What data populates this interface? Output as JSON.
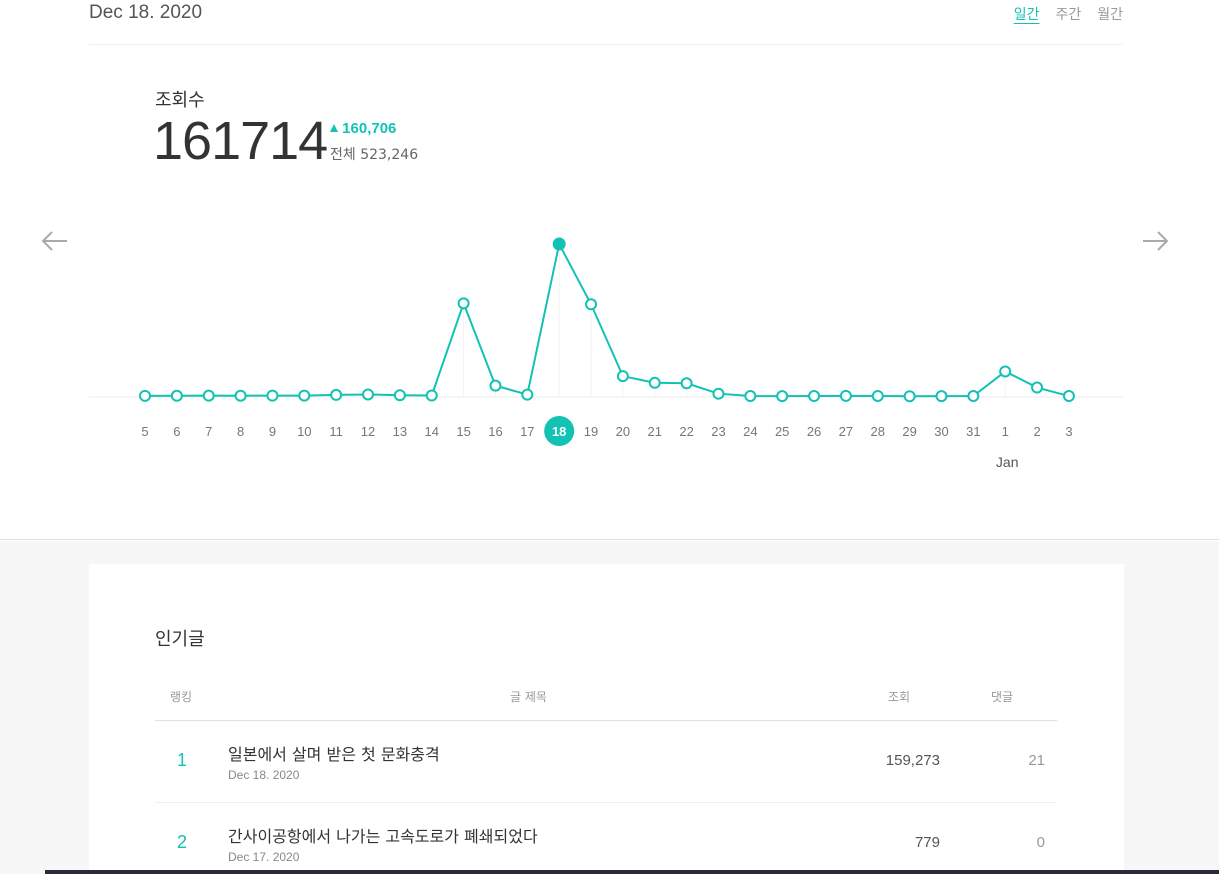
{
  "header": {
    "date_title": "Dec 18. 2020",
    "tabs": [
      {
        "label": "일간",
        "active": true
      },
      {
        "label": "주간",
        "active": false
      },
      {
        "label": "월간",
        "active": false
      }
    ]
  },
  "metric": {
    "label": "조회수",
    "value": "161714",
    "delta": "160,706",
    "total": "전체 523,246"
  },
  "icons": {
    "prev": "arrow-left-icon",
    "next": "arrow-right-icon",
    "delta": "triangle-up-icon"
  },
  "colors": {
    "accent": "#12c2b4"
  },
  "chart_data": {
    "type": "line",
    "categories": [
      "5",
      "6",
      "7",
      "8",
      "9",
      "10",
      "11",
      "12",
      "13",
      "14",
      "15",
      "16",
      "17",
      "18",
      "19",
      "20",
      "21",
      "22",
      "23",
      "24",
      "25",
      "26",
      "27",
      "28",
      "29",
      "30",
      "31",
      "1",
      "2",
      "3"
    ],
    "values": [
      1200,
      1300,
      1400,
      1350,
      1450,
      1500,
      2200,
      2700,
      1900,
      1600,
      99000,
      12000,
      2500,
      161714,
      98000,
      22000,
      15000,
      14500,
      3500,
      1000,
      900,
      1000,
      1200,
      1100,
      800,
      900,
      1000,
      27000,
      10000,
      1008
    ],
    "highlight": "18",
    "month_label": "Jan",
    "series": [
      {
        "name": "",
        "values": []
      }
    ],
    "title": "",
    "xlabel": "",
    "ylabel": "",
    "grid": false
  },
  "popular": {
    "title": "인기글",
    "columns": {
      "rank": "랭킹",
      "title": "글 제목",
      "views": "조회",
      "comments": "댓글"
    },
    "rows": [
      {
        "rank": "1",
        "title": "일본에서 살며 받은 첫 문화충격",
        "date": "Dec 18. 2020",
        "views": "159,273",
        "comments": "21"
      },
      {
        "rank": "2",
        "title": "간사이공항에서 나가는 고속도로가 폐쇄되었다",
        "date": "Dec 17. 2020",
        "views": "779",
        "comments": "0"
      }
    ]
  }
}
